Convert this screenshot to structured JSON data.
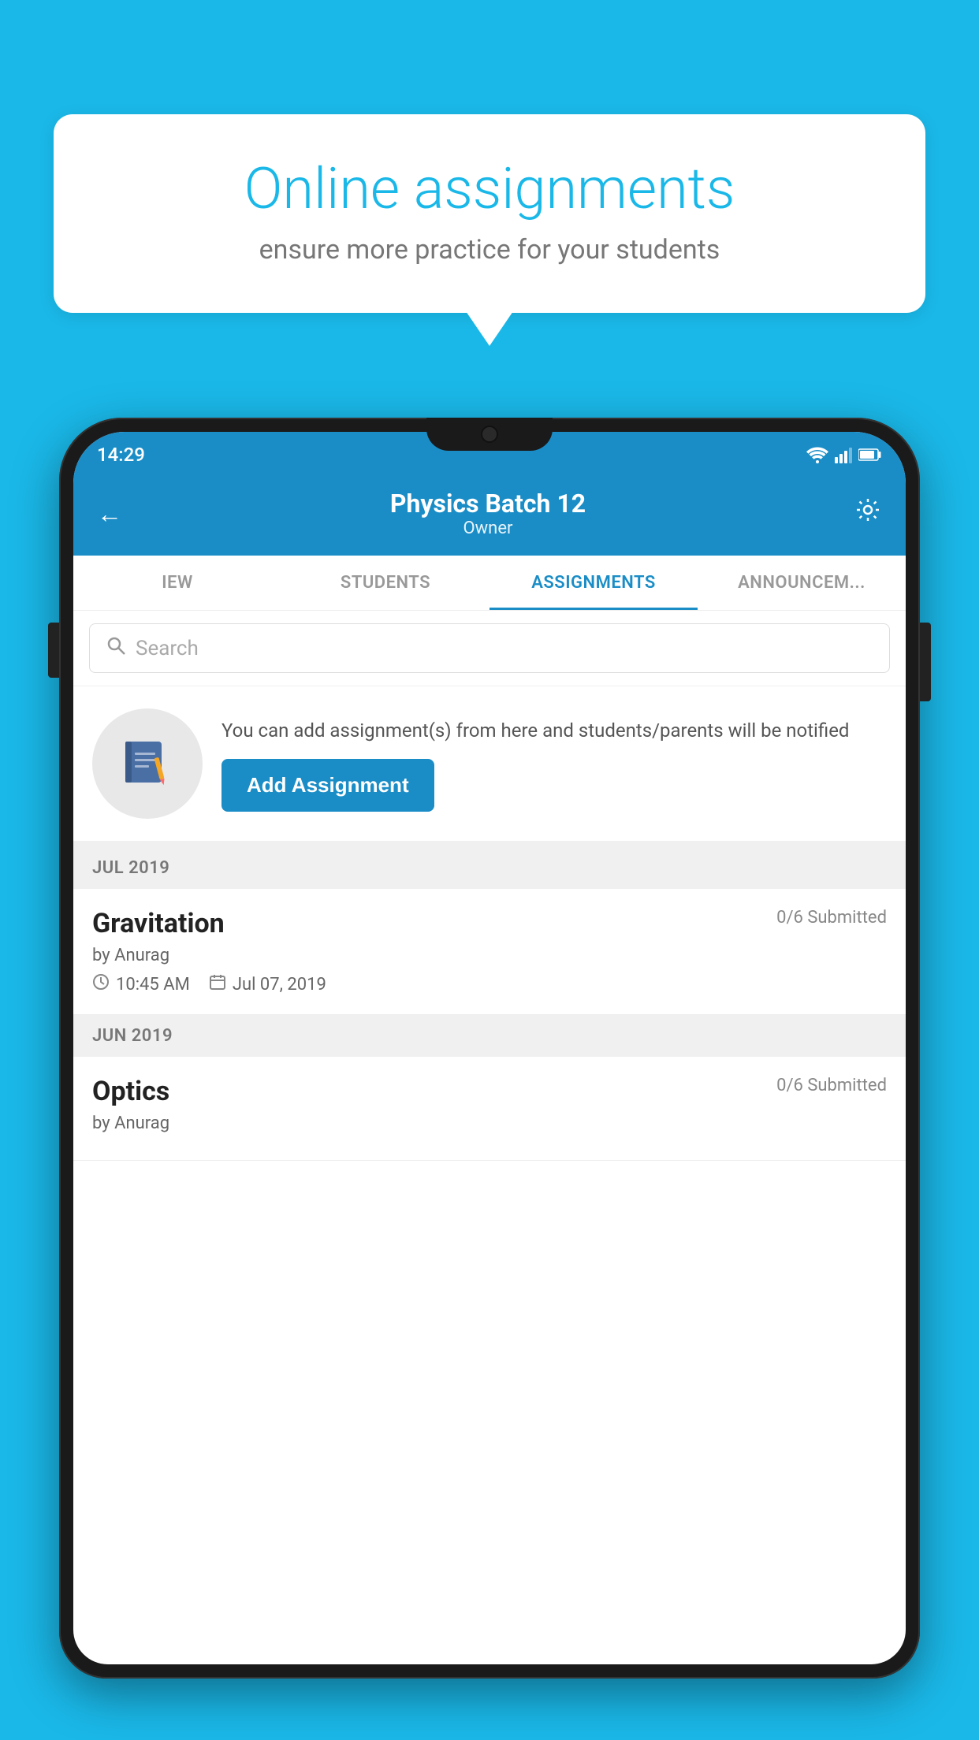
{
  "background_color": "#1ab8e8",
  "speech_bubble": {
    "title": "Online assignments",
    "subtitle": "ensure more practice for your students"
  },
  "status_bar": {
    "time": "14:29"
  },
  "header": {
    "title": "Physics Batch 12",
    "subtitle": "Owner"
  },
  "tabs": [
    {
      "id": "overview",
      "label": "IEW",
      "active": false
    },
    {
      "id": "students",
      "label": "STUDENTS",
      "active": false
    },
    {
      "id": "assignments",
      "label": "ASSIGNMENTS",
      "active": true
    },
    {
      "id": "announcements",
      "label": "ANNOUNCEM...",
      "active": false
    }
  ],
  "search": {
    "placeholder": "Search"
  },
  "promo": {
    "text": "You can add assignment(s) from here and students/parents will be notified",
    "button_label": "Add Assignment"
  },
  "sections": [
    {
      "month": "JUL 2019",
      "assignments": [
        {
          "name": "Gravitation",
          "submitted": "0/6 Submitted",
          "author": "by Anurag",
          "time": "10:45 AM",
          "date": "Jul 07, 2019"
        }
      ]
    },
    {
      "month": "JUN 2019",
      "assignments": [
        {
          "name": "Optics",
          "submitted": "0/6 Submitted",
          "author": "by Anurag",
          "time": "",
          "date": ""
        }
      ]
    }
  ]
}
